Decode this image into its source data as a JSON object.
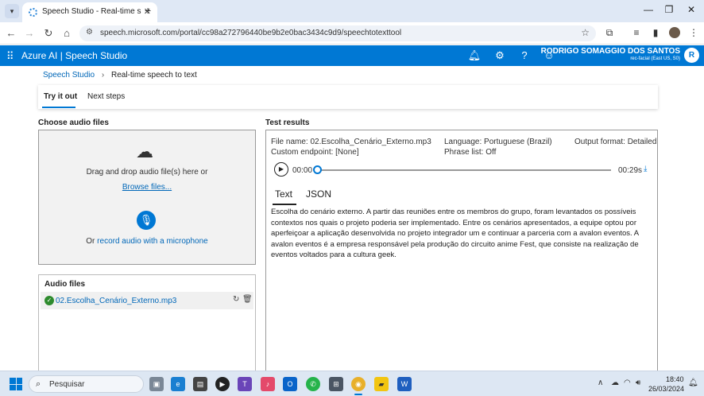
{
  "browser": {
    "tab_title": "Speech Studio - Real-time speech",
    "url": "speech.microsoft.com/portal/cc98a272796440be9b2e0bac3434c9d9/speechtotexttool"
  },
  "header": {
    "brand": "Azure AI  |  Speech Studio",
    "user_name": "RODRIGO SOMAGGIO DOS SANTOS",
    "user_sub": "rec-facial (East US, S0)",
    "avatar_letter": "R"
  },
  "breadcrumb": {
    "root": "Speech Studio",
    "current": "Real-time speech to text"
  },
  "tabs": [
    "Try it out",
    "Next steps"
  ],
  "choose_audio": {
    "label": "Choose audio files",
    "drop_text": "Drag and drop audio file(s) here or",
    "browse": "Browse files...",
    "record_prefix": "Or",
    "record_link": "record audio with a microphone"
  },
  "audio_files": {
    "title": "Audio files",
    "items": [
      "02.Escolha_Cenário_Externo.mp3"
    ]
  },
  "results": {
    "label": "Test results",
    "file_name": "File name: 02.Escolha_Cenário_Externo.mp3",
    "language": "Language: Portuguese (Brazil)",
    "output_format": "Output format: Detailed",
    "custom_endpoint": "Custom endpoint: [None]",
    "phrase_list": "Phrase list: Off",
    "time_start": "00:00",
    "time_end": "00:29s",
    "tabs": [
      "Text",
      "JSON"
    ],
    "transcript": "Escolha do cenário externo. A partir das reuniões entre os membros do grupo, foram levantados os possíveis contextos nos quais o projeto poderia ser implementado. Entre os cenários apresentados, a equipe optou por aperfeiçoar a aplicação desenvolvida no projeto integrador um e continuar a parceria com a avalon eventos. A avalon eventos é a empresa responsável pela produção do circuito anime Fest, que consiste na realização de eventos voltados para a cultura geek."
  },
  "taskbar": {
    "search": "Pesquisar",
    "time": "18:40",
    "date": "26/03/2024"
  },
  "colors": {
    "accent": "#0078d4",
    "link": "#0067b8"
  }
}
